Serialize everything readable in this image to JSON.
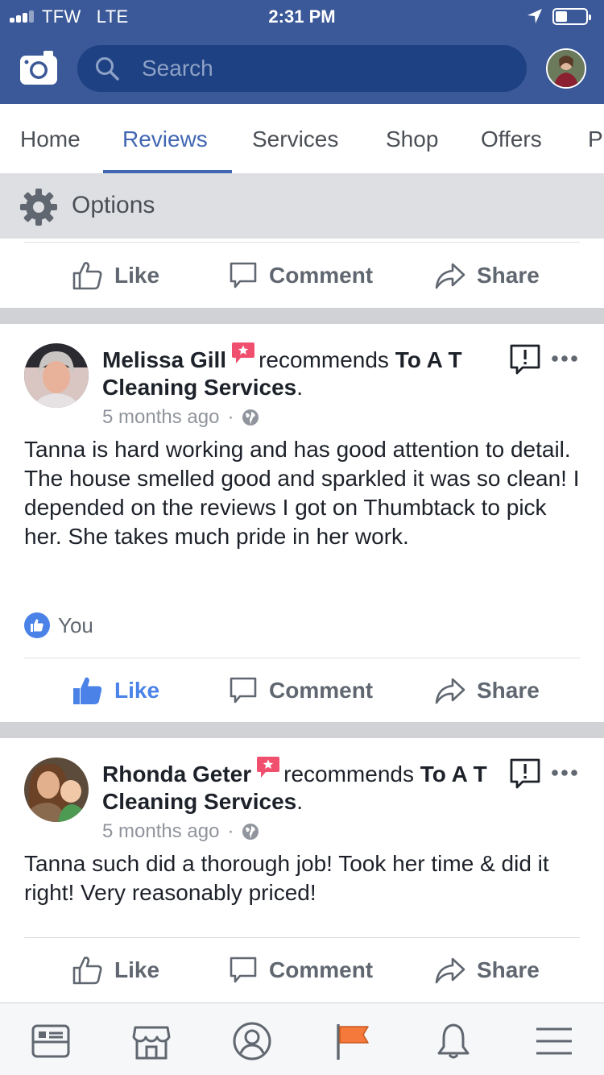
{
  "status_bar": {
    "carrier": "TFW",
    "network": "LTE",
    "time": "2:31 PM"
  },
  "search": {
    "placeholder": "Search"
  },
  "tabs": [
    {
      "label": "Home",
      "active": false
    },
    {
      "label": "Reviews",
      "active": true
    },
    {
      "label": "Services",
      "active": false
    },
    {
      "label": "Shop",
      "active": false
    },
    {
      "label": "Offers",
      "active": false
    },
    {
      "label": "P",
      "active": false
    }
  ],
  "options": {
    "label": "Options"
  },
  "actions": {
    "like": "Like",
    "comment": "Comment",
    "share": "Share"
  },
  "reviews": [
    {
      "author": "Melissa Gill",
      "verb": "recommends",
      "business": "To A T Cleaning Services",
      "time": "5 months ago",
      "text": "Tanna is hard working and has good attention to detail.  The house smelled good and sparkled it was so clean!  I depended on the reviews I got on Thumbtack to pick her.  She takes much pride in her work.",
      "reactions": "You",
      "liked": true
    },
    {
      "author": "Rhonda Geter",
      "verb": "recommends",
      "business": "To A T Cleaning Services",
      "time": "5 months ago",
      "text": "Tanna such did a thorough job! Took her time & did it right! Very reasonably priced!",
      "liked": false
    }
  ],
  "colors": {
    "brand": "#3b5998",
    "search_bg": "#1d4182",
    "tab_active": "#4267b2",
    "like_active": "#4a82e8",
    "recommend_badge": "#f0506e",
    "pages_flag": "#f5793a"
  },
  "bottom_nav": [
    "news-feed-icon",
    "marketplace-icon",
    "profile-icon",
    "pages-flag-icon",
    "notifications-bell-icon",
    "menu-icon"
  ]
}
